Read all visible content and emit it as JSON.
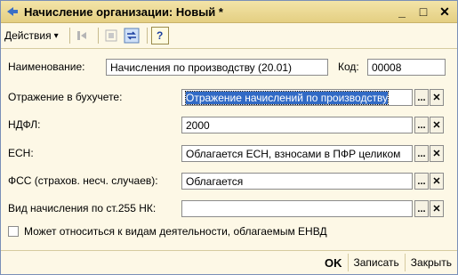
{
  "window": {
    "title": "Начисление организации: Новый *",
    "minimize": "_",
    "maximize": "□",
    "close": "✕"
  },
  "toolbar": {
    "actions_label": "Действия",
    "actions_arrow": "▾",
    "help_label": "?"
  },
  "form": {
    "name_label": "Наименование:",
    "name_value": "Начисления по производству (20.01)",
    "code_label": "Код:",
    "code_value": "00008",
    "accounting_label": "Отражение в бухучете:",
    "accounting_value": "Отражение начислений по производству",
    "ndfl_label": "НДФЛ:",
    "ndfl_value": "2000",
    "esn_label": "ЕСН:",
    "esn_value": "Облагается ЕСН, взносами в ПФР целиком",
    "fss_label": "ФСС (страхов. несч. случаев):",
    "fss_value": "Облагается",
    "vid_label": "Вид начисления по ст.255 НК:",
    "vid_value": "",
    "envd_label": "Может относиться к видам деятельности, облагаемым  ЕНВД",
    "envd_checked": false,
    "select_btn": "...",
    "clear_btn": "✕"
  },
  "footer": {
    "ok_label": "OK",
    "save_label": "Записать",
    "close_label": "Закрыть"
  }
}
